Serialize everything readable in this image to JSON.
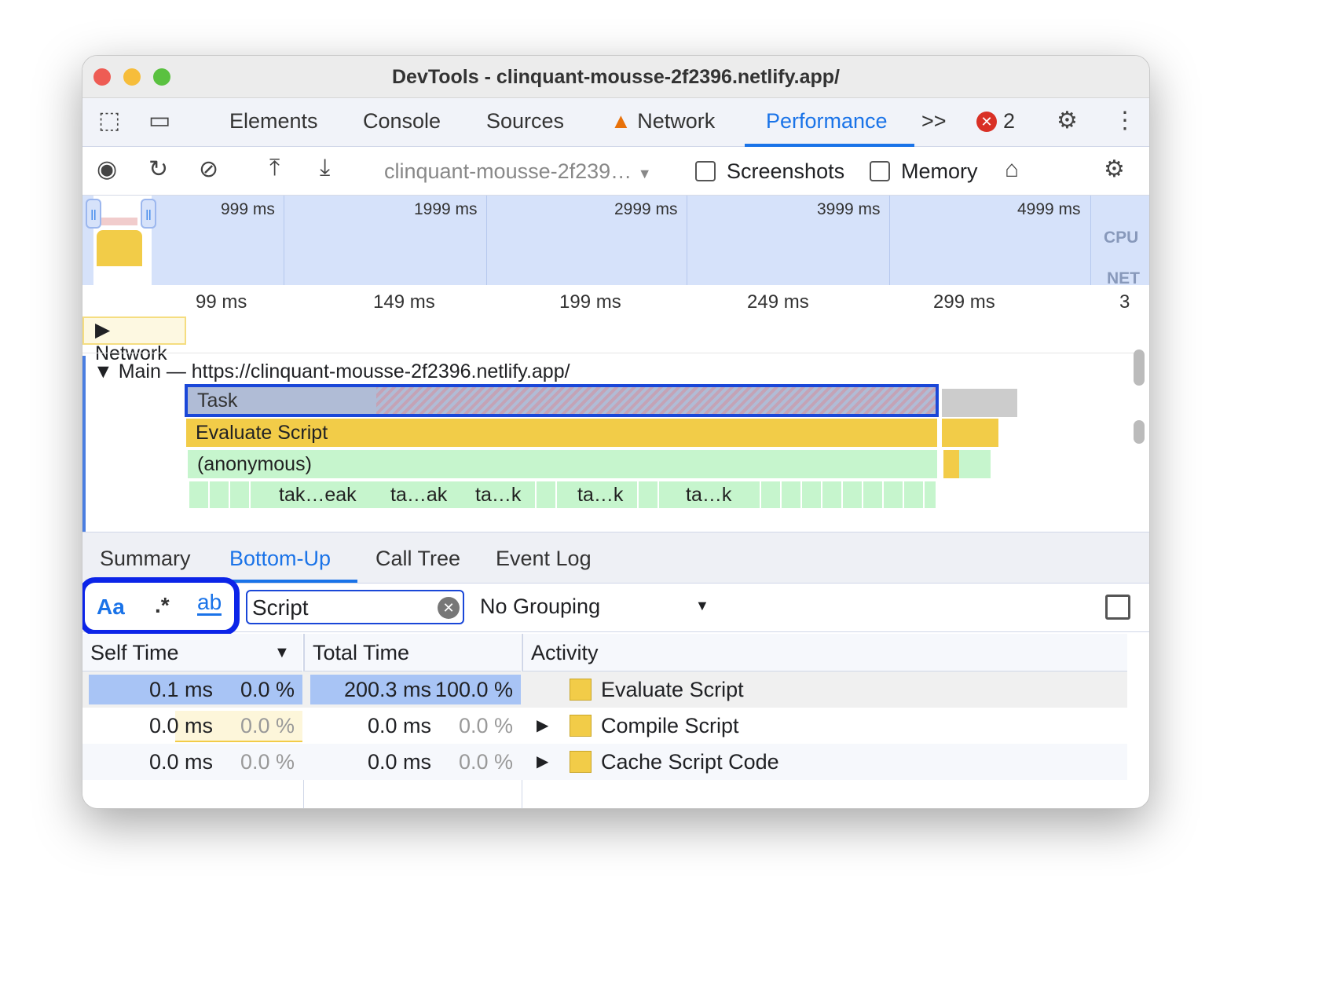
{
  "window": {
    "title": "DevTools - clinquant-mousse-2f2396.netlify.app/"
  },
  "tabs": [
    {
      "label": "Elements"
    },
    {
      "label": "Console"
    },
    {
      "label": "Sources"
    },
    {
      "label": "Network",
      "warning": true
    },
    {
      "label": "Performance",
      "active": true
    }
  ],
  "more_tabs": ">>",
  "error_count": "2",
  "toolbar": {
    "url_select": "clinquant-mousse-2f239…",
    "screenshots_label": "Screenshots",
    "memory_label": "Memory",
    "screenshots_checked": false,
    "memory_checked": false
  },
  "overview": {
    "ticks": [
      "999 ms",
      "1999 ms",
      "2999 ms",
      "3999 ms",
      "4999 ms"
    ],
    "cpu_label": "CPU",
    "net_label": "NET"
  },
  "ruler": {
    "ticks": [
      "99 ms",
      "149 ms",
      "199 ms",
      "249 ms",
      "299 ms",
      "3"
    ]
  },
  "tracks": {
    "network_label": "Network",
    "main_label": "Main — https://clinquant-mousse-2f2396.netlify.app/"
  },
  "flame": {
    "task": "Task",
    "evaluate": "Evaluate Script",
    "anonymous": "(anonymous)",
    "children": [
      "tak…eak",
      "ta…ak",
      "ta…k",
      "ta…k",
      "ta…k"
    ]
  },
  "bottom_tabs": [
    {
      "label": "Summary"
    },
    {
      "label": "Bottom-Up",
      "active": true
    },
    {
      "label": "Call Tree"
    },
    {
      "label": "Event Log"
    }
  ],
  "filter": {
    "match_case": "Aa",
    "regex": ".*",
    "whole_word": "ab",
    "value": "Script",
    "grouping": "No Grouping"
  },
  "table": {
    "headers": {
      "self": "Self Time",
      "total": "Total Time",
      "activity": "Activity"
    },
    "rows": [
      {
        "self_ms": "0.1 ms",
        "self_pct": "0.0 %",
        "total_ms": "200.3 ms",
        "total_pct": "100.0 %",
        "activity": "Evaluate Script",
        "expandable": false
      },
      {
        "self_ms": "0.0 ms",
        "self_pct": "0.0 %",
        "total_ms": "0.0 ms",
        "total_pct": "0.0 %",
        "activity": "Compile Script",
        "expandable": true
      },
      {
        "self_ms": "0.0 ms",
        "self_pct": "0.0 %",
        "total_ms": "0.0 ms",
        "total_pct": "0.0 %",
        "activity": "Cache Script Code",
        "expandable": true
      }
    ]
  },
  "colors": {
    "accent": "#1a73e8",
    "highlight": "#0b24e8",
    "script": "#f2cc48",
    "task": "#b0bcd6",
    "js": "#c6f5cd",
    "selected_row": "#a8c4f5"
  }
}
